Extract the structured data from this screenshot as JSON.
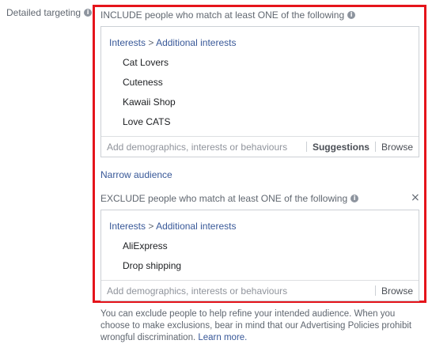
{
  "label": {
    "text": "Detailed targeting",
    "info_icon": "i"
  },
  "include": {
    "heading": "INCLUDE people who match at least ONE of the following",
    "crumb_parent": "Interests",
    "crumb_separator": ">",
    "crumb_child": "Additional interests",
    "items": [
      "Cat Lovers",
      "Cuteness",
      "Kawaii Shop",
      "Love CATS"
    ],
    "placeholder": "Add demographics, interests or behaviours",
    "suggestions_label": "Suggestions",
    "browse_label": "Browse"
  },
  "narrow_audience": "Narrow audience",
  "exclude": {
    "heading": "EXCLUDE people who match at least ONE of the following",
    "close_symbol": "×",
    "crumb_parent": "Interests",
    "crumb_separator": ">",
    "crumb_child": "Additional interests",
    "items": [
      "AliExpress",
      "Drop shipping"
    ],
    "placeholder": "Add demographics, interests or behaviours",
    "browse_label": "Browse"
  },
  "note": {
    "text": "You can exclude people to help refine your intended audience. When you choose to make exclusions, bear in mind that our Advertising Policies prohibit wrongful discrimination.",
    "link": "Learn more."
  },
  "colors": {
    "highlight": "#e5141b",
    "link": "#385898"
  }
}
